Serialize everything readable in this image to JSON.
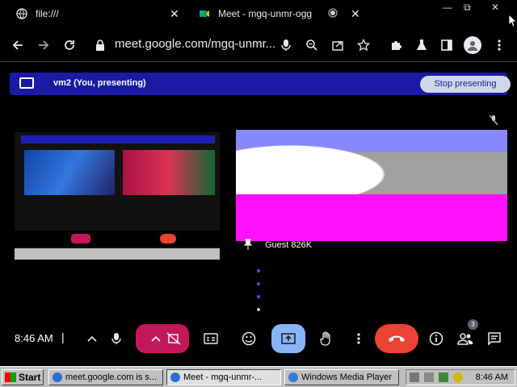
{
  "tabs": [
    {
      "title": "file:///",
      "close": "✕"
    },
    {
      "title": "Meet - mgq-unmr-ogg",
      "close": "✕"
    }
  ],
  "window_controls": {
    "minimize": "—",
    "restore": "⧉",
    "close": "✕"
  },
  "address_bar": {
    "url": "meet.google.com/mgq-unmr..."
  },
  "banner": {
    "text": "vm2 (You, presenting)",
    "stop_label": "Stop presenting"
  },
  "guest": {
    "name": "Guest 826K"
  },
  "controls": {
    "time": "8:46 AM",
    "separator": "|",
    "people_count": "3"
  },
  "taskbar": {
    "start": "Start",
    "items": [
      {
        "label": "meet.google.com is s..."
      },
      {
        "label": "Meet - mgq-unmr-..."
      },
      {
        "label": "Windows Media Player"
      }
    ],
    "time": "8:46 AM"
  }
}
